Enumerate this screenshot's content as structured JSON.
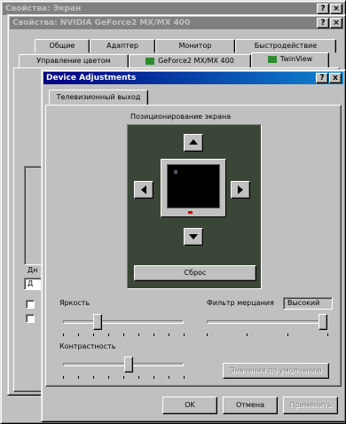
{
  "display_properties": {
    "title": "Свойства: Экран"
  },
  "nvidia_properties": {
    "title": "Свойства: NVIDIA GeForce2 MX/MX 400",
    "tabs_row1": [
      "Общие",
      "Адаптер",
      "Монитор",
      "Быстродействие"
    ],
    "tabs_row2": [
      "Управление цветом",
      "GeForce2 MX/MX 400",
      "TwinView"
    ],
    "left_labels": [
      "Дн",
      "Д"
    ]
  },
  "device_adjustments": {
    "title": "Device Adjustments",
    "help_glyph": "?",
    "close_glyph": "x",
    "tab": "Телевизионный выход",
    "positioning_label": "Позиционирование экрана",
    "reset_button": "Сброс",
    "brightness_label": "Яркость",
    "brightness_value": 0.27,
    "contrast_label": "Контрастность",
    "contrast_value": 0.55,
    "flicker_filter_label": "Фильтр мерцания",
    "flicker_filter_value_label": "Высокий",
    "flicker_filter_value": 1.0,
    "defaults_button": "Значения по умолчанию",
    "ok_button": "OK",
    "cancel_button": "Отмена",
    "apply_button": "Применить"
  },
  "icons": [
    "help-icon",
    "close-icon",
    "arrow-up-icon",
    "arrow-down-icon",
    "arrow-left-icon",
    "arrow-right-icon",
    "monitor-icon",
    "nvidia-logo-icon"
  ],
  "colors": {
    "active_title": "#000080",
    "inactive_title": "#808080",
    "face": "#c0c0c0",
    "positioning_bg": "#3b4638",
    "screen": "#000000"
  }
}
